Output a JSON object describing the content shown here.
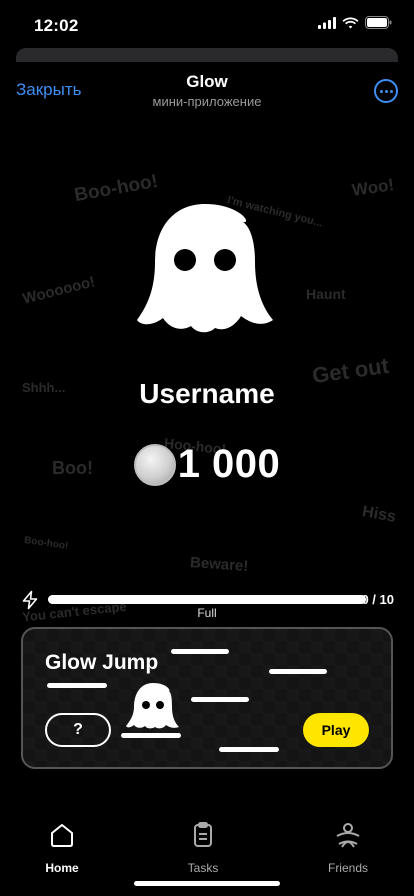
{
  "status_bar": {
    "time": "12:02"
  },
  "header": {
    "close_label": "Закрыть",
    "title": "Glow",
    "subtitle": "мини-приложение"
  },
  "background_words": [
    "Boo-hoo!",
    "I'm watching you...",
    "Woo!",
    "Haunt",
    "Woooooo!",
    "Get out",
    "Shhh...",
    "Boo!",
    "Hiss",
    "Boo-hoo!",
    "Beware!",
    "You can't escape",
    "Hoo-hoo!"
  ],
  "profile": {
    "username": "Username",
    "balance": "1 000"
  },
  "energy": {
    "count": "10 / 10",
    "status": "Full",
    "fraction": 1.0
  },
  "game": {
    "title": "Glow Jump",
    "help_label": "?",
    "play_label": "Play"
  },
  "nav": {
    "items": [
      {
        "label": "Home",
        "icon": "home-icon",
        "active": true
      },
      {
        "label": "Tasks",
        "icon": "clipboard-icon",
        "active": false
      },
      {
        "label": "Friends",
        "icon": "friends-icon",
        "active": false
      }
    ]
  },
  "colors": {
    "accent_blue": "#3f8ef5",
    "play_yellow": "#ffe600"
  }
}
